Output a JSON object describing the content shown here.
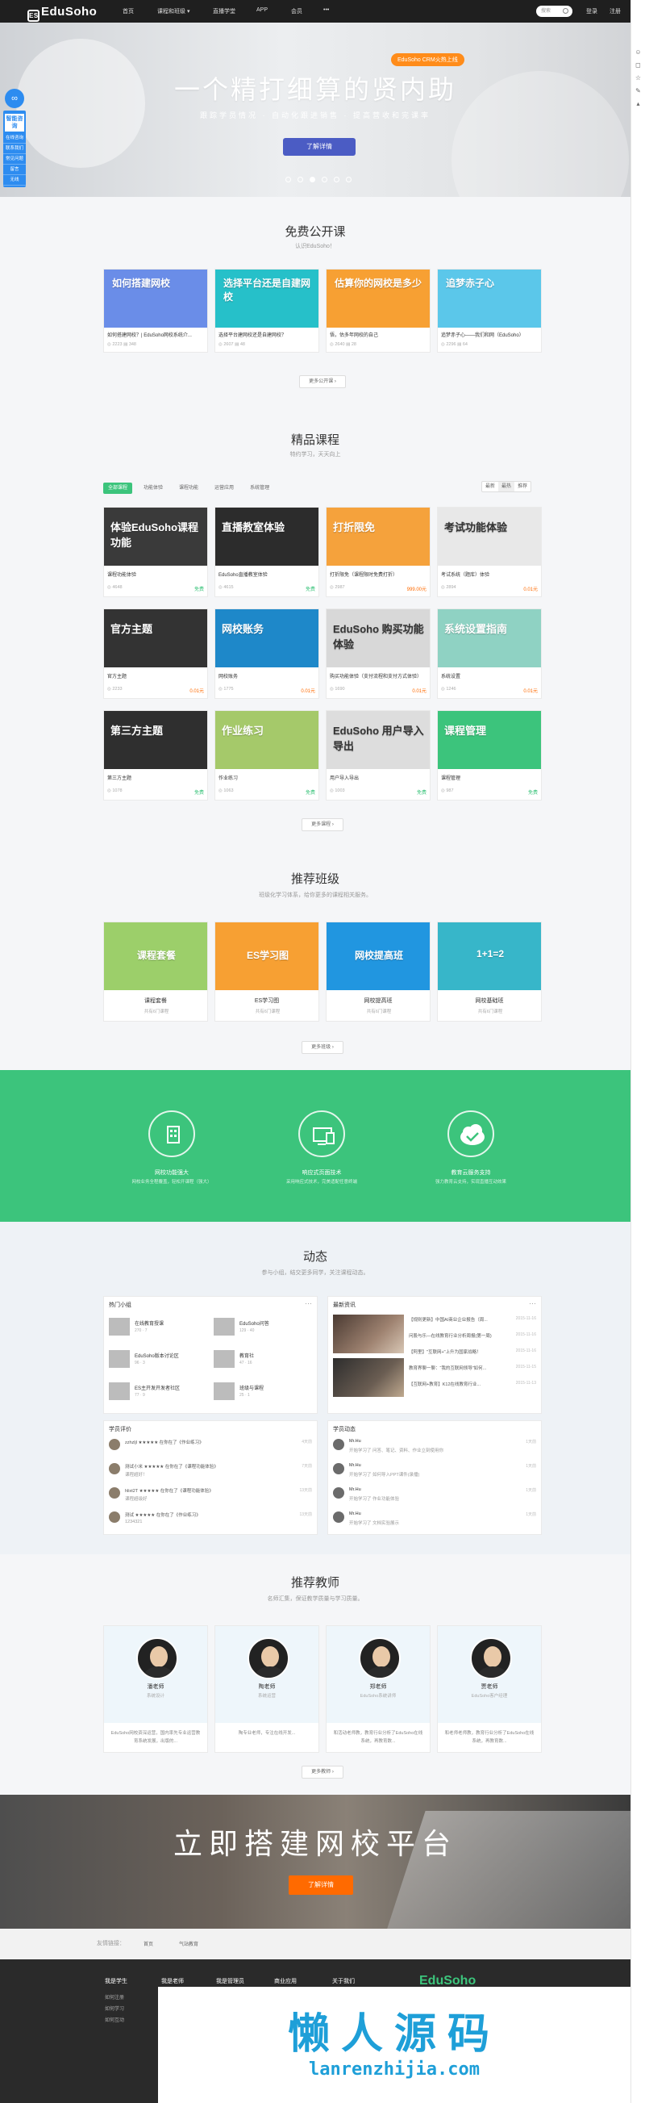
{
  "nav": {
    "logo": "EduSoho",
    "items": [
      "首页",
      "课程和班级 ▾",
      "直播学堂",
      "APP",
      "会员",
      "•••"
    ],
    "search_placeholder": "搜索",
    "login": "登录",
    "register": "注册"
  },
  "hero": {
    "badge": "EduSoho CRM火热上线",
    "title": "一个精打细算的贤内助",
    "subtitle": "跟踪学员情况 · 自动化跟进销售 · 提高营收和完课率",
    "button": "了解详情",
    "slide_count": 6,
    "active_slide": 2
  },
  "left_float": {
    "circle": "∞",
    "title": "智能咨询",
    "items": [
      "在线咨询",
      "联系我们",
      "常见问题",
      "留言",
      "无线"
    ]
  },
  "free_courses": {
    "title": "免费公开课",
    "subtitle": "认识EduSoho！",
    "more": "更多公开课 ›",
    "items": [
      {
        "thumb_text": "如何搭建网校",
        "title": "如何搭建网校？| EduSoho网校系统介...",
        "views": "2223",
        "comments": "348",
        "color": "#6a8de8"
      },
      {
        "thumb_text": "选择平台还是自建网校",
        "title": "选择平台建网校还是自建网校？",
        "views": "2607",
        "comments": "48",
        "color": "#26c0c9"
      },
      {
        "thumb_text": "估算你的网校是多少",
        "title": "悟，估多年网校的自己",
        "views": "2640",
        "comments": "28",
        "color": "#f7a033"
      },
      {
        "thumb_text": "追梦赤子心",
        "title": "追梦赤子心——我们和网（EduSoho）",
        "views": "2296",
        "comments": "64",
        "color": "#5bc7ea"
      }
    ]
  },
  "courses": {
    "title": "精品课程",
    "subtitle": "特约学习，天天向上",
    "tabs": [
      "全部课程",
      "功能体验",
      "课程功能",
      "运营应用",
      "系统管理"
    ],
    "sorts": [
      "最新",
      "最热",
      "推荐"
    ],
    "more": "更多课程 ›",
    "items": [
      {
        "thumb_text": "体验EduSoho课程功能",
        "title": "课程功能体验",
        "meta": "4648",
        "price": "免费",
        "color": "#3a3a3a",
        "free": true
      },
      {
        "thumb_text": "直播教室体验",
        "title": "EduSoho直播教室体验",
        "meta": "4615",
        "price": "免费",
        "color": "#2c2c2c",
        "free": true
      },
      {
        "thumb_text": "打折限免",
        "title": "打折限免（课程限时免费打折）",
        "meta": "2987",
        "price": "999.00元",
        "color": "#f5a23c",
        "free": false
      },
      {
        "thumb_text": "考试功能体验",
        "title": "考试系统（题库）体验",
        "meta": "2894",
        "price": "0.01元",
        "color": "#e8e8e8",
        "free": false
      },
      {
        "thumb_text": "官方主题",
        "title": "官方主题",
        "meta": "2233",
        "price": "0.01元",
        "color": "#333333",
        "free": false
      },
      {
        "thumb_text": "网校账务",
        "title": "网校账务",
        "meta": "1775",
        "price": "0.01元",
        "color": "#1e88c9",
        "free": false
      },
      {
        "thumb_text": "EduSoho 购买功能体验",
        "title": "购买功能体验（支付流程和支付方式体验）",
        "meta": "1690",
        "price": "0.01元",
        "color": "#d8d8d8",
        "free": false
      },
      {
        "thumb_text": "系统设置指南",
        "title": "系统设置",
        "meta": "1246",
        "price": "0.01元",
        "color": "#8fd2c3",
        "free": false
      },
      {
        "thumb_text": "第三方主题",
        "title": "第三方主题",
        "meta": "1078",
        "price": "免费",
        "color": "#2f2f2f",
        "free": true
      },
      {
        "thumb_text": "作业练习",
        "title": "作业练习",
        "meta": "1063",
        "price": "免费",
        "color": "#a5c96a",
        "free": true
      },
      {
        "thumb_text": "EduSoho 用户导入导出",
        "title": "用户导入导出",
        "meta": "1003",
        "price": "免费",
        "color": "#ddd",
        "free": true
      },
      {
        "thumb_text": "课程管理",
        "title": "课程管理",
        "meta": "987",
        "price": "免费",
        "color": "#3cc47c",
        "free": true
      }
    ]
  },
  "classes": {
    "title": "推荐班级",
    "subtitle": "班级化学习体系，给你更多的课程相关服务。",
    "more": "更多班级 ›",
    "items": [
      {
        "thumb_text": "课程套餐",
        "title": "课程套餐",
        "sub": "共有6门课程",
        "color": "#9ccf6a"
      },
      {
        "thumb_text": "ES学习图",
        "title": "ES学习图",
        "sub": "共有6门课程",
        "color": "#f7a033"
      },
      {
        "thumb_text": "网校提高班",
        "title": "网校提高班",
        "sub": "共有6门课程",
        "color": "#2196e0"
      },
      {
        "thumb_text": "1+1=2",
        "title": "网校基础班",
        "sub": "共有6门课程",
        "color": "#37b6c9"
      }
    ]
  },
  "features": {
    "items": [
      {
        "title": "网校功能强大",
        "sub": "网校业务全程覆盖，轻松开课程（强大）"
      },
      {
        "title": "响应式页面技术",
        "sub": "采用响应式技术，完美适配任意终端"
      },
      {
        "title": "教育云服务支持",
        "sub": "强力教育云支持，实现直播互动效果"
      }
    ]
  },
  "activity": {
    "title": "动态",
    "subtitle": "参与小组，结交更多同学，关注课程动态。",
    "groups_title": "热门小组",
    "groups": [
      {
        "name": "在线教育授课",
        "m": "270 · 7"
      },
      {
        "name": "EduSoho问答",
        "m": "129 · 40"
      },
      {
        "name": "EduSoho版本讨论区",
        "m": "96 · 3"
      },
      {
        "name": "教育社",
        "m": "47 · 16"
      },
      {
        "name": "ES主开发开发者社区",
        "m": "77 · 9"
      },
      {
        "name": "班级与课程",
        "m": "25 · 1"
      }
    ],
    "news_title": "最新资讯",
    "news": [
      {
        "t": "【规则更新】中国AI商业企业报告（周...",
        "d": "2015-11-16"
      },
      {
        "t": "问股与乐—在线教育行业分析周报(第一周)",
        "d": "2015-11-16"
      },
      {
        "t": "【阿里】\"互联网+\"上升为国家战略！",
        "d": "2015-11-16"
      },
      {
        "t": "教育界聊一聊：“我的互联网领导”如何...",
        "d": "2015-11-15"
      },
      {
        "t": "【互联网+教育】K12在线教育行业...",
        "d": "2015-11-13"
      }
    ],
    "reviews_title": "学员评价",
    "reviews": [
      {
        "u": "zzhzljl ★★★★★ 在你在了《作业练习》",
        "c": "",
        "d": "4天前"
      },
      {
        "u": "测试小米 ★★★★★ 在你在了《课程功能体验》",
        "c": "课程超好！",
        "d": "7天前"
      },
      {
        "u": "hlixt2T ★★★★★ 在你在了《课程功能体验》",
        "c": "课程超级好",
        "d": "13天前"
      },
      {
        "u": "测试 ★★★★★ 在你在了《作业练习》",
        "c": "1234321",
        "d": "13天前"
      }
    ],
    "dynamics_title": "学员动态",
    "dynamics": [
      {
        "u": "Mr.Hu",
        "c": "开始学习了 问答、笔记、资料、作业立刻使用你",
        "d": "1天前"
      },
      {
        "u": "Mr.Hu",
        "c": "开始学习了 如何导入PPT课件(录播)",
        "d": "1天前"
      },
      {
        "u": "Mr.Hu",
        "c": "开始学习了 作业功能体验",
        "d": "1天前"
      },
      {
        "u": "Mr.Hu",
        "c": "开始学习了 文档实验展示",
        "d": "1天前"
      }
    ]
  },
  "teachers": {
    "title": "推荐教师",
    "subtitle": "名师汇集，保证教学质量与学习质量。",
    "more": "更多教师 ›",
    "items": [
      {
        "name": "潘老师",
        "role": "系统设计",
        "desc": "EduSoho网校资深运营，国内率先专业运营教育系统发展，出版的..."
      },
      {
        "name": "陶老师",
        "role": "系统运营",
        "desc": "陶专业老师，专注在线开发..."
      },
      {
        "name": "郑老师",
        "role": "EduSoho系统讲师",
        "desc": "和活动老师教，教育行业分析了EduSoho在线系统，再教育数..."
      },
      {
        "name": "贾老师",
        "role": "EduSoho客户经理",
        "desc": "和老师老师教，教育行业分析了EduSoho在线系统，再教育数..."
      }
    ]
  },
  "cta": {
    "title": "立即搭建网校平台",
    "button": "了解详情"
  },
  "links": {
    "label": "友情链接：",
    "items": [
      "首页",
      "气站教育"
    ]
  },
  "footer": {
    "cols": [
      {
        "h": "我是学生",
        "items": [
          "如何注册",
          "如何学习",
          "如何互动"
        ]
      },
      {
        "h": "我是老师",
        "items": []
      },
      {
        "h": "我是管理员",
        "items": []
      },
      {
        "h": "商业应用",
        "items": []
      },
      {
        "h": "关于我们",
        "items": []
      }
    ],
    "logo": "EduSoho"
  },
  "watermark": {
    "title": "懒人源码",
    "url": "lanrenzhijia.com"
  }
}
